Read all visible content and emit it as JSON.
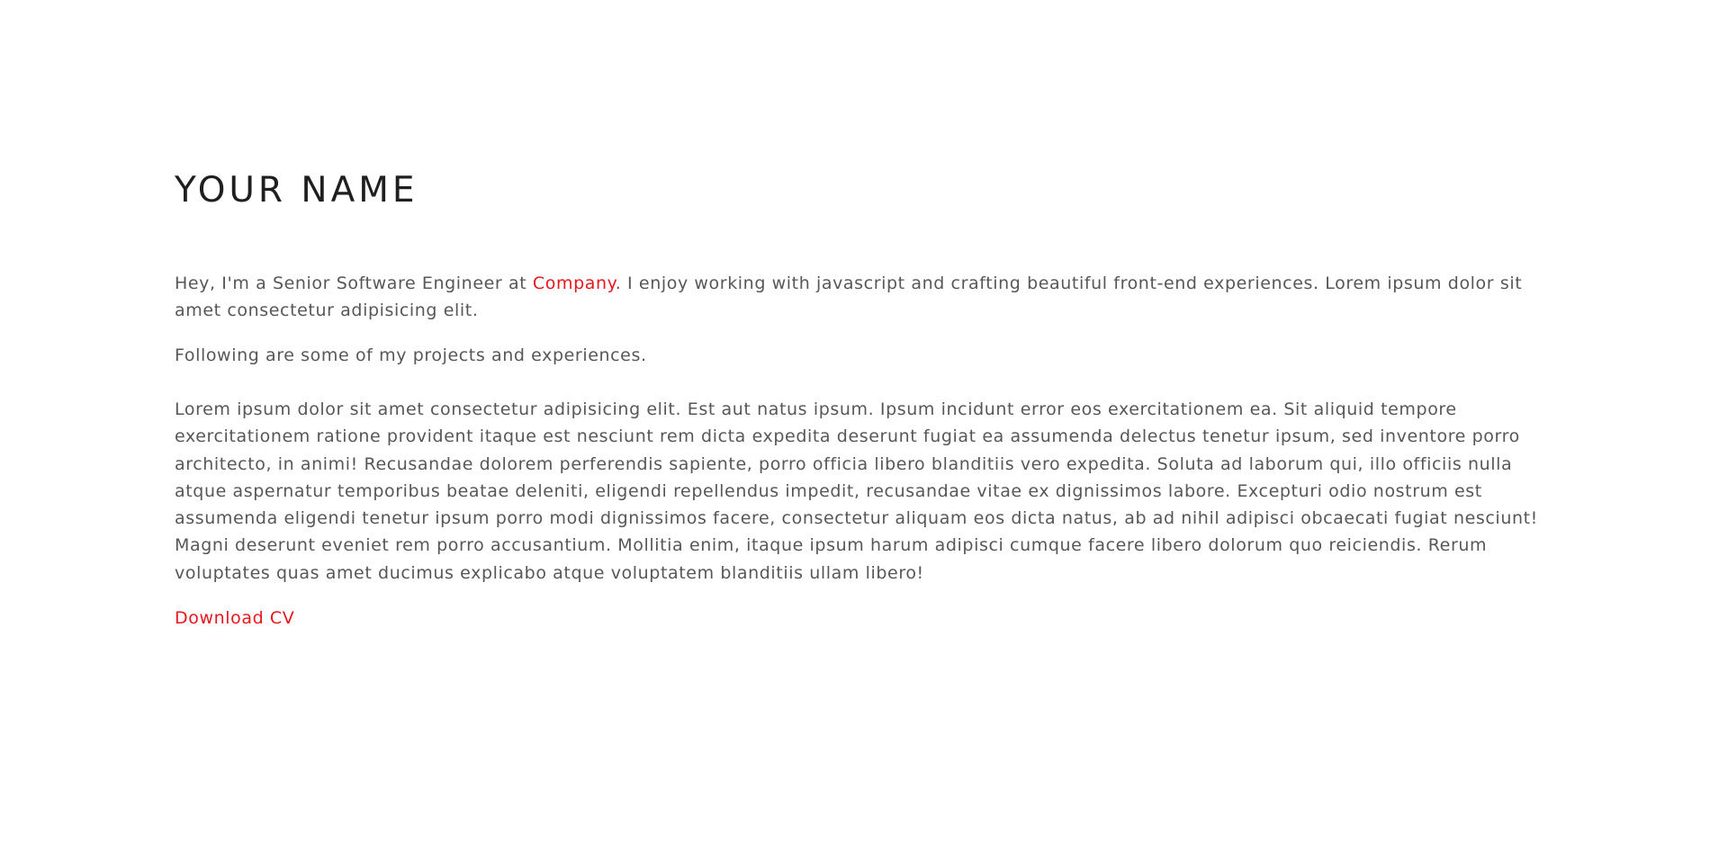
{
  "header": {
    "name": "YOUR NAME"
  },
  "about": {
    "intro_prefix": "Hey, I'm a Senior Software Engineer at ",
    "company_link": "Company",
    "intro_suffix": ". I enjoy working with javascript and crafting beautiful front-end experiences. Lorem ipsum dolor sit amet consectetur adipisicing elit.",
    "projects_intro": "Following are some of my projects and experiences."
  },
  "description": "Lorem ipsum dolor sit amet consectetur adipisicing elit. Est aut natus ipsum. Ipsum incidunt error eos exercitationem ea. Sit aliquid tempore exercitationem ratione provident itaque est nesciunt rem dicta expedita deserunt fugiat ea assumenda delectus tenetur ipsum, sed inventore porro architecto, in animi! Recusandae dolorem perferendis sapiente, porro officia libero blanditiis vero expedita. Soluta ad laborum qui, illo officiis nulla atque aspernatur temporibus beatae deleniti, eligendi repellendus impedit, recusandae vitae ex dignissimos labore. Excepturi odio nostrum est assumenda eligendi tenetur ipsum porro modi dignissimos facere, consectetur aliquam eos dicta natus, ab ad nihil adipisci obcaecati fugiat nesciunt! Magni deserunt eveniet rem porro accusantium. Mollitia enim, itaque ipsum harum adipisci cumque facere libero dolorum quo reiciendis. Rerum voluptates quas amet ducimus explicabo atque voluptatem blanditiis ullam libero!",
  "actions": {
    "download_cv": "Download CV"
  },
  "colors": {
    "accent": "#e8171c",
    "text": "#575757",
    "heading": "#1f1f1f",
    "background": "#ffffff"
  }
}
